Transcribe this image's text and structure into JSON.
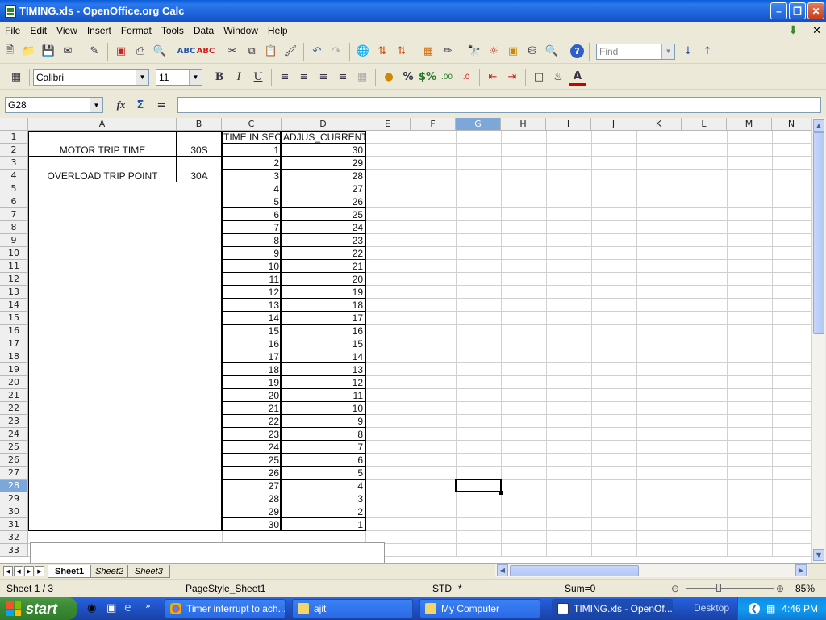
{
  "window": {
    "title": "TIMING.xls - OpenOffice.org Calc"
  },
  "menu": [
    "File",
    "Edit",
    "View",
    "Insert",
    "Format",
    "Tools",
    "Data",
    "Window",
    "Help"
  ],
  "toolbar": {
    "find_placeholder": "Find"
  },
  "format_toolbar": {
    "font": "Calibri",
    "size": "11"
  },
  "formula_bar": {
    "cell_ref": "G28",
    "content": ""
  },
  "columns": [
    "A",
    "B",
    "C",
    "D",
    "E",
    "F",
    "G",
    "H",
    "I",
    "J",
    "K",
    "L",
    "M",
    "N"
  ],
  "rows": [
    "1",
    "2",
    "3",
    "4",
    "5",
    "6",
    "7",
    "8",
    "9",
    "10",
    "11",
    "12",
    "13",
    "14",
    "15",
    "16",
    "17",
    "18",
    "19",
    "20",
    "21",
    "22",
    "23",
    "24",
    "25",
    "26",
    "27",
    "28",
    "29",
    "30",
    "31",
    "32",
    "33"
  ],
  "cells": {
    "motor_trip_label": "MOTOR TRIP TIME",
    "motor_trip_value": "30S",
    "overload_label": "OVERLOAD TRIP POINT",
    "overload_value": "30A",
    "header_c": "TIME IN SEC",
    "header_d": "ADJUS_CURRENT",
    "time_values": [
      "1",
      "2",
      "3",
      "4",
      "5",
      "6",
      "7",
      "8",
      "9",
      "10",
      "11",
      "12",
      "13",
      "14",
      "15",
      "16",
      "17",
      "18",
      "19",
      "20",
      "21",
      "22",
      "23",
      "24",
      "25",
      "26",
      "27",
      "28",
      "29",
      "30"
    ],
    "current_values": [
      "30",
      "29",
      "28",
      "27",
      "26",
      "25",
      "24",
      "23",
      "22",
      "21",
      "20",
      "19",
      "18",
      "17",
      "16",
      "15",
      "14",
      "13",
      "12",
      "11",
      "10",
      "9",
      "8",
      "7",
      "6",
      "5",
      "4",
      "3",
      "2",
      "1"
    ]
  },
  "sheets": [
    "Sheet1",
    "Sheet2",
    "Sheet3"
  ],
  "active_sheet": "Sheet1",
  "status": {
    "sheet": "Sheet 1 / 3",
    "page_style": "PageStyle_Sheet1",
    "mode": "STD",
    "modified": "*",
    "sum": "Sum=0",
    "zoom": "85%"
  },
  "taskbar": {
    "start": "start",
    "tasks": [
      "Timer interrupt to ach...",
      "ajit",
      "My Computer",
      "TIMING.xls - OpenOf..."
    ],
    "desktop": "Desktop",
    "clock": "4:46 PM"
  },
  "selected_cell": {
    "column": "G",
    "row": "28"
  }
}
